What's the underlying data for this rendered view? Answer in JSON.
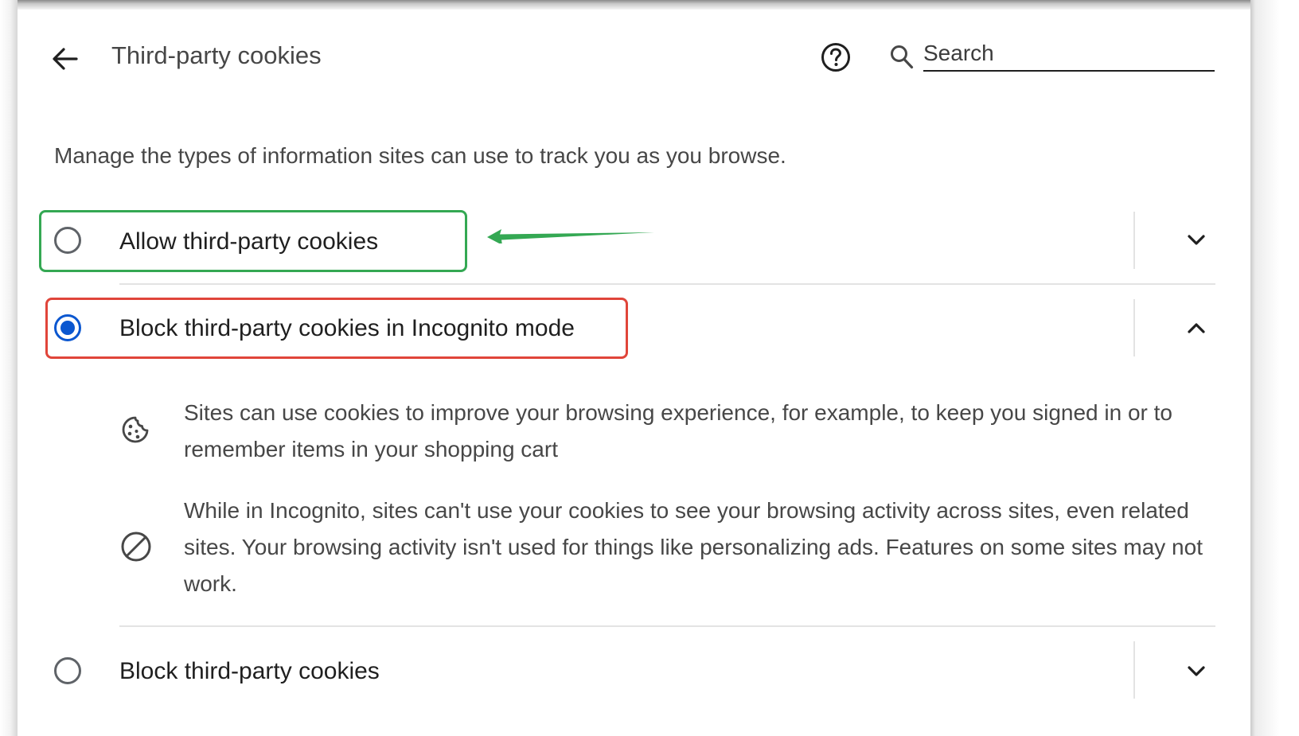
{
  "header": {
    "title": "Third-party cookies",
    "search_placeholder": "Search"
  },
  "description": "Manage the types of information sites can use to track you as you browse.",
  "options": [
    {
      "label": "Allow third-party cookies",
      "selected": false,
      "expanded": false
    },
    {
      "label": "Block third-party cookies in Incognito mode",
      "selected": true,
      "expanded": true
    },
    {
      "label": "Block third-party cookies",
      "selected": false,
      "expanded": false
    }
  ],
  "details": [
    {
      "icon": "cookie-icon",
      "text": "Sites can use cookies to improve your browsing experience, for example, to keep you signed in or to remember items in your shopping cart"
    },
    {
      "icon": "block-icon",
      "text": "While in Incognito, sites can't use your cookies to see your browsing activity across sites, even related sites. Your browsing activity isn't used for things like personalizing ads. Features on some sites may not work."
    }
  ],
  "colors": {
    "accent": "#0b57d0",
    "annotation_green": "#34a853",
    "annotation_red": "#e0453a"
  }
}
